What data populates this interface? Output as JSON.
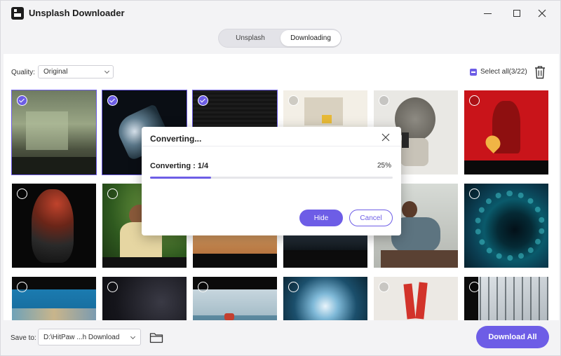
{
  "app": {
    "title": "Unsplash Downloader",
    "logo_icon": "unsplash-logo-icon"
  },
  "tabs": [
    {
      "label": "Unsplash",
      "active": false
    },
    {
      "label": "Downloading",
      "active": true
    }
  ],
  "toolbar": {
    "quality_label": "Quality:",
    "quality_value": "Original",
    "select_all_label": "Select all(3/22)"
  },
  "grid": {
    "items": [
      {
        "selected": true,
        "scene": "abandoned-room"
      },
      {
        "selected": true,
        "scene": "abstract-3d-shape"
      },
      {
        "selected": true,
        "scene": "dark-texture"
      },
      {
        "selected": false,
        "scene": "still-life-beige"
      },
      {
        "selected": false,
        "scene": "person-with-mirror"
      },
      {
        "selected": false,
        "scene": "person-red-background"
      },
      {
        "selected": false,
        "scene": "dark-sculpture"
      },
      {
        "selected": false,
        "scene": "woman-in-saree"
      },
      {
        "selected": false,
        "scene": "desert-dunes"
      },
      {
        "selected": false,
        "scene": "dark-water"
      },
      {
        "selected": false,
        "scene": "woman-with-laptop"
      },
      {
        "selected": false,
        "scene": "teal-dotted-swirl"
      },
      {
        "selected": false,
        "scene": "underwater-reef"
      },
      {
        "selected": false,
        "scene": "starry-night-sky"
      },
      {
        "selected": false,
        "scene": "beach-person"
      },
      {
        "selected": false,
        "scene": "sunlight-cave"
      },
      {
        "selected": false,
        "scene": "red-boots"
      },
      {
        "selected": false,
        "scene": "glass-building"
      }
    ]
  },
  "bottombar": {
    "save_label": "Save to:",
    "save_path": "D:\\HitPaw ...h Download",
    "download_all_label": "Download All"
  },
  "dialog": {
    "title": "Converting...",
    "progress_label": "Converting : 1/4",
    "progress_percent": "25%",
    "progress_fraction": 0.25,
    "hide_label": "Hide",
    "cancel_label": "Cancel"
  },
  "colors": {
    "accent": "#6d5de6"
  }
}
